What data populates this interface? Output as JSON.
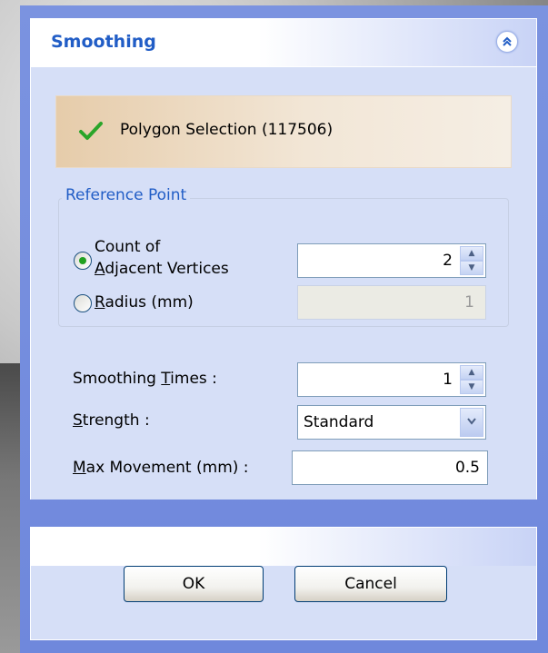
{
  "panel": {
    "title": "Smoothing",
    "collapse_icon": "double-chevron-up-icon"
  },
  "selection": {
    "icon": "green-checkmark-icon",
    "label": "Polygon Selection (117506)"
  },
  "reference_point": {
    "legend": "Reference Point",
    "options": [
      {
        "label_line1": "Count of",
        "label_line2_accel": "A",
        "label_line2_rest": "djacent Vertices",
        "selected": true
      },
      {
        "label_accel": "R",
        "label_rest": "adius (mm)",
        "selected": false
      }
    ],
    "count_value": "2",
    "radius_value": "1"
  },
  "settings": {
    "smoothing_times": {
      "pre": "Smoothing ",
      "accel": "T",
      "post": "imes :",
      "value": "1"
    },
    "strength": {
      "pre": "",
      "accel": "S",
      "post": "trength :",
      "value": "Standard"
    },
    "max_movement": {
      "pre": "",
      "accel": "M",
      "post": "ax Movement (mm) :",
      "value": "0.5"
    }
  },
  "buttons": {
    "ok": "OK",
    "cancel": "Cancel"
  },
  "colors": {
    "accent": "#215dc6",
    "frame": "#7b93e0",
    "panel": "#d6dff7"
  }
}
